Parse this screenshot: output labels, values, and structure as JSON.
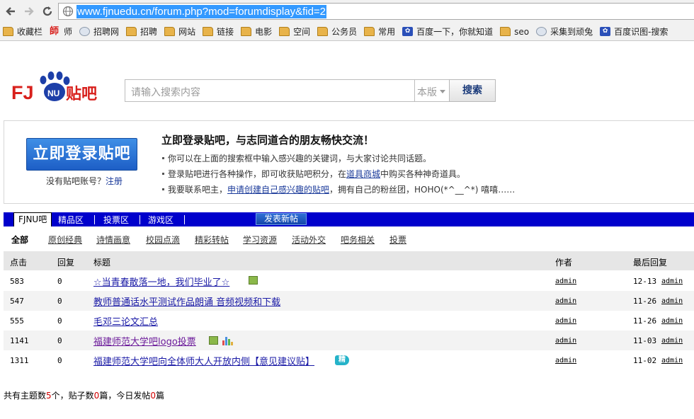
{
  "browser": {
    "url": "www.fjnuedu.cn/forum.php?mod=forumdisplay&fid=2",
    "bookmarks": [
      "收藏栏",
      "师",
      "招聘网",
      "招聘",
      "网站",
      "链接",
      "电影",
      "空间",
      "公务员",
      "常用",
      "百度一下，你就知道",
      "seo",
      "采集到顽兔",
      "百度识图-搜索"
    ]
  },
  "header": {
    "logo_prefix": "FJ",
    "logo_badge": "NU",
    "logo_suffix": "贴吧",
    "search_placeholder": "请输入搜索内容",
    "scope_label": "本版",
    "search_button": "搜索"
  },
  "login": {
    "button_label": "立即登录贴吧",
    "no_account_text": "没有贴吧账号？",
    "register_link": "注册",
    "promo_title": "立即登录贴吧，与志同道合的朋友畅快交流！",
    "promo_line1": "你可以在上面的搜索框中输入感兴趣的关键词，与大家讨论共同话题。",
    "promo_line2_before": "登录贴吧进行各种操作，即可收获贴吧积分，在",
    "promo_line2_link": "道具商城",
    "promo_line2_after": "中购买各种神奇道具。",
    "promo_line3_before": "我要联系吧主，",
    "promo_line3_link": "申请创建自己感兴趣的贴吧",
    "promo_line3_after": "，拥有自己的粉丝团，HOHO(*^__^*) 嘻嘻……"
  },
  "tabs": [
    {
      "label": "FJNU吧",
      "active": true
    },
    {
      "label": "精品区",
      "active": false
    },
    {
      "label": "投票区",
      "active": false
    },
    {
      "label": "游戏区",
      "active": false
    }
  ],
  "post_button": "发表新帖",
  "categories": [
    "全部",
    "原创经典",
    "诗情画意",
    "校园点滴",
    "精彩转帖",
    "学习资源",
    "活动外交",
    "吧务相关",
    "投票"
  ],
  "table": {
    "headers": {
      "clicks": "点击",
      "replies": "回复",
      "title": "标题",
      "author": "作者",
      "last_reply": "最后回复"
    },
    "rows": [
      {
        "clicks": "583",
        "replies": "0",
        "title": "☆当青春散落一地，我们毕业了☆",
        "author": "admin",
        "date": "12-13",
        "last_user": "admin"
      },
      {
        "clicks": "547",
        "replies": "0",
        "title": "教师普通话水平测试作品朗诵 音频视频和下载",
        "author": "admin",
        "date": "11-26",
        "last_user": "admin"
      },
      {
        "clicks": "555",
        "replies": "0",
        "title": "毛邓三论文汇总",
        "author": "admin",
        "date": "11-26",
        "last_user": "admin"
      },
      {
        "clicks": "1141",
        "replies": "0",
        "title": "福建师范大学吧logo投票",
        "author": "admin",
        "date": "11-03",
        "last_user": "admin"
      },
      {
        "clicks": "1311",
        "replies": "0",
        "title": "福建师范大学吧向全体师大人开放内侧【意见建议贴】",
        "author": "admin",
        "date": "11-02",
        "last_user": "admin"
      }
    ]
  },
  "badges": {
    "digest": "精"
  },
  "footer": {
    "t1": "共有主题数",
    "topics": "5",
    "t2": "个，贴子数",
    "posts": "0",
    "t3": "篇，今日发帖",
    "today": "0",
    "t4": "篇"
  },
  "colors": {
    "tabbar": "#0000cc",
    "link": "#1a1aa6",
    "visited": "#6b1a9a",
    "logo_red": "#d8201c",
    "logo_blue": "#1d3fa8",
    "count_red": "#d00000"
  }
}
